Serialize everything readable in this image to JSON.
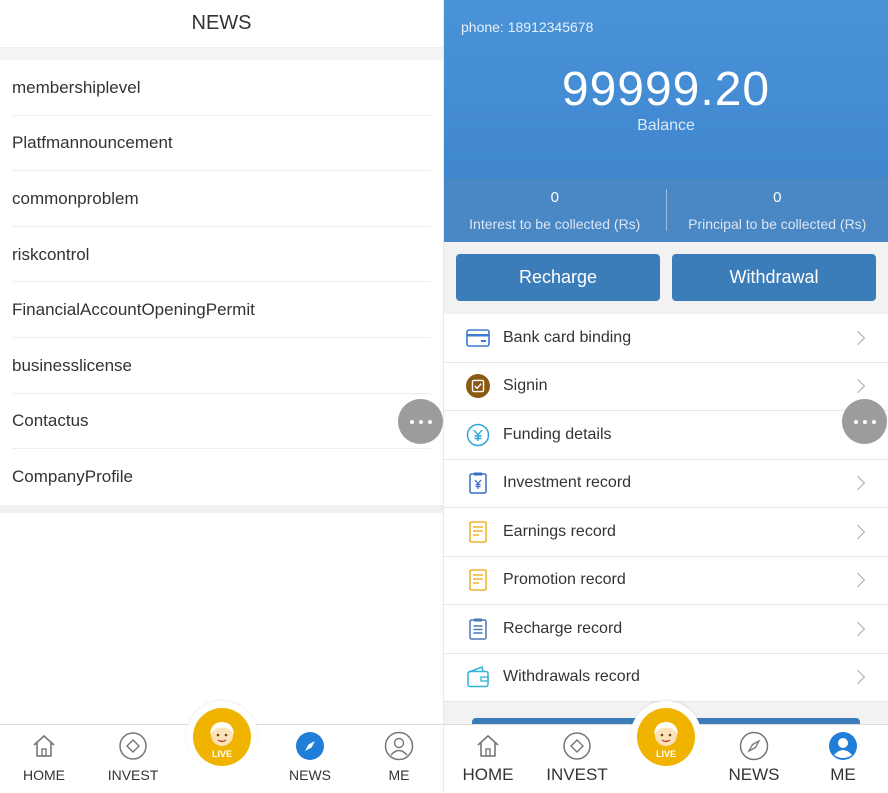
{
  "left": {
    "header": {
      "title": "NEWS"
    },
    "news_items": [
      "membershiplevel",
      "Platfmannouncement",
      "commonproblem",
      "riskcontrol",
      "FinancialAccountOpeningPermit",
      "businesslicense",
      "Contactus",
      "CompanyProfile"
    ],
    "tabbar": {
      "home": "HOME",
      "invest": "INVEST",
      "live": "LIVE",
      "news": "NEWS",
      "me": "ME"
    }
  },
  "right": {
    "phone": "phone: 18912345678",
    "balance": "99999.20",
    "balance_label": "Balance",
    "stats": [
      {
        "value": "0",
        "label": "Interest to be collected (Rs)"
      },
      {
        "value": "0",
        "label": "Principal to be collected (Rs)"
      }
    ],
    "buttons": {
      "recharge": "Recharge",
      "withdrawal": "Withdrawal"
    },
    "menu": [
      {
        "label": "Bank card binding",
        "icon": "bank-card-icon"
      },
      {
        "label": "Signin",
        "icon": "signin-icon"
      },
      {
        "label": "Funding details",
        "icon": "yen-circle-icon"
      },
      {
        "label": "Investment record",
        "icon": "clipboard-yen-icon"
      },
      {
        "label": "Earnings record",
        "icon": "document-icon"
      },
      {
        "label": "Promotion record",
        "icon": "document-icon"
      },
      {
        "label": "Recharge record",
        "icon": "clipboard-list-icon"
      },
      {
        "label": "Withdrawals record",
        "icon": "wallet-icon"
      }
    ],
    "tabbar": {
      "home": "HOME",
      "invest": "INVEST",
      "live": "LIVE",
      "news": "NEWS",
      "me": "ME"
    }
  },
  "colors": {
    "accent_blue": "#3b7db8",
    "hero_blue": "#4a93d8",
    "live_gold": "#f0b400",
    "signin_brown": "#8a5a14"
  }
}
